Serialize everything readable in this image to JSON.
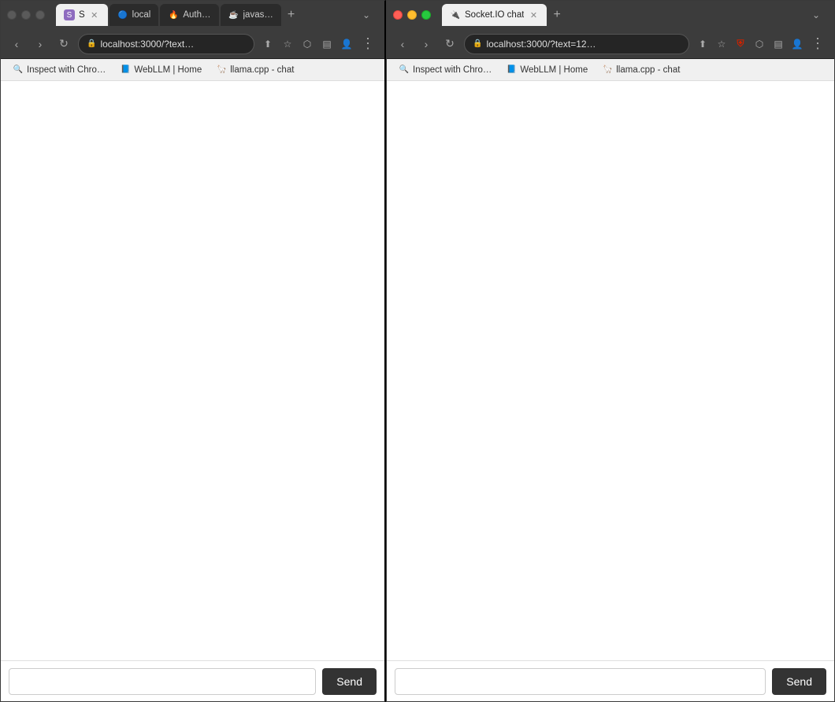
{
  "left_browser": {
    "traffic_lights": [
      {
        "color": "inactive",
        "label": "close"
      },
      {
        "color": "inactive",
        "label": "minimize"
      },
      {
        "color": "inactive",
        "label": "maximize"
      }
    ],
    "tabs": [
      {
        "id": "tab-s",
        "favicon": "S",
        "favicon_bg": "#8e6bbf",
        "label": "S",
        "active": true,
        "has_close": true
      },
      {
        "id": "tab-local",
        "favicon": "🔵",
        "favicon_bg": "transparent",
        "label": "local",
        "active": false,
        "has_close": false
      },
      {
        "id": "tab-auth",
        "favicon": "🔥",
        "favicon_bg": "transparent",
        "label": "Auth…",
        "active": false,
        "has_close": false
      },
      {
        "id": "tab-java",
        "favicon": "☕",
        "favicon_bg": "transparent",
        "label": "javas…",
        "active": false,
        "has_close": false
      }
    ],
    "add_tab_label": "+",
    "overflow_label": "⌄",
    "url": "localhost:3000/?text…",
    "nav": {
      "back_disabled": false,
      "forward_disabled": false
    },
    "bookmarks": [
      {
        "label": "Inspect with Chro…",
        "favicon": "🔍"
      },
      {
        "label": "WebLLM | Home",
        "favicon": "📘"
      },
      {
        "label": "llama.cpp - chat",
        "favicon": "🦙"
      }
    ],
    "chat_input_placeholder": "",
    "chat_input_value": "",
    "send_button_label": "Send"
  },
  "right_browser": {
    "traffic_lights": [
      {
        "color": "close",
        "label": "close"
      },
      {
        "color": "min",
        "label": "minimize"
      },
      {
        "color": "max",
        "label": "maximize"
      }
    ],
    "tabs": [
      {
        "id": "tab-socketio",
        "favicon": "🔌",
        "favicon_bg": "transparent",
        "label": "Socket.IO chat",
        "active": true,
        "has_close": true
      }
    ],
    "add_tab_label": "+",
    "overflow_label": "⌄",
    "url": "localhost:3000/?text=12…",
    "nav": {
      "back_disabled": false,
      "forward_disabled": false
    },
    "bookmarks": [
      {
        "label": "Inspect with Chro…",
        "favicon": "🔍"
      },
      {
        "label": "WebLLM | Home",
        "favicon": "📘"
      },
      {
        "label": "llama.cpp - chat",
        "favicon": "🦙"
      }
    ],
    "chat_input_placeholder": "",
    "chat_input_value": "",
    "send_button_label": "Send"
  }
}
